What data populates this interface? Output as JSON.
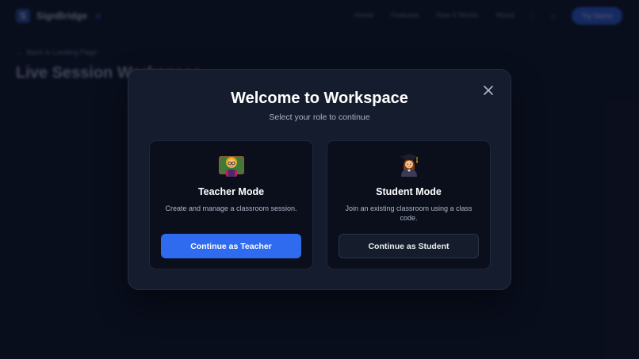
{
  "navbar": {
    "brand_name": "SignBridge",
    "brand_suffix": "ai",
    "brand_logo_letter": "S",
    "links": [
      "Home",
      "Features",
      "How it Works",
      "About"
    ],
    "theme_icon": "sun-icon",
    "cta_label": "Try Demo"
  },
  "page": {
    "back_link": "Back to Landing Page",
    "heading": "Live Session Workspace"
  },
  "modal": {
    "title": "Welcome to Workspace",
    "subtitle": "Select your role to continue",
    "close_icon": "close-icon",
    "roles": [
      {
        "emoji": "teacher-emoji-icon",
        "title": "Teacher Mode",
        "description": "Create and manage a classroom session.",
        "button_label": "Continue as Teacher"
      },
      {
        "emoji": "student-emoji-icon",
        "title": "Student Mode",
        "description": "Join an existing classroom using a class code.",
        "button_label": "Continue as Student"
      }
    ]
  },
  "colors": {
    "background": "#0c1122",
    "modal_bg": "#151c2d",
    "card_bg": "#0b0f1c",
    "primary": "#2f6bee"
  }
}
